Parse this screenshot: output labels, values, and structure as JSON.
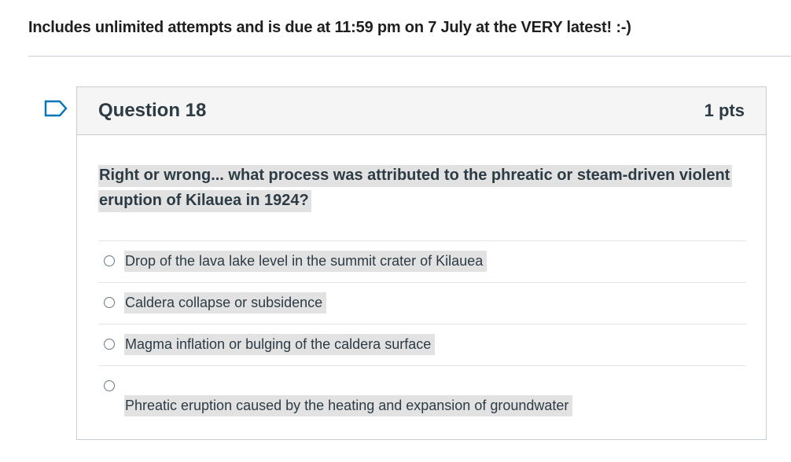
{
  "header": {
    "instructions": "Includes unlimited attempts and is due at 11:59 pm on 7 July at the VERY latest! :-)"
  },
  "question": {
    "flag_icon": "bookmark-flag-icon",
    "title": "Question 18",
    "points": "1 pts",
    "text": "Right or wrong... what process was attributed to the phreatic or steam-driven violent eruption of Kilauea in 1924?",
    "answers": [
      {
        "label": "Drop of the lava lake level in the summit crater of Kilauea",
        "selected": false
      },
      {
        "label": "Caldera collapse or subsidence",
        "selected": false
      },
      {
        "label": "Magma inflation or bulging of the caldera surface",
        "selected": false
      },
      {
        "label": "Phreatic eruption caused by the heating and expansion of groundwater",
        "selected": false
      }
    ]
  },
  "colors": {
    "text": "#2d3b45",
    "header_bg": "#f5f5f5",
    "highlight": "#e2e2e2",
    "border": "#c7cdd1",
    "flag": "#0374b5"
  }
}
